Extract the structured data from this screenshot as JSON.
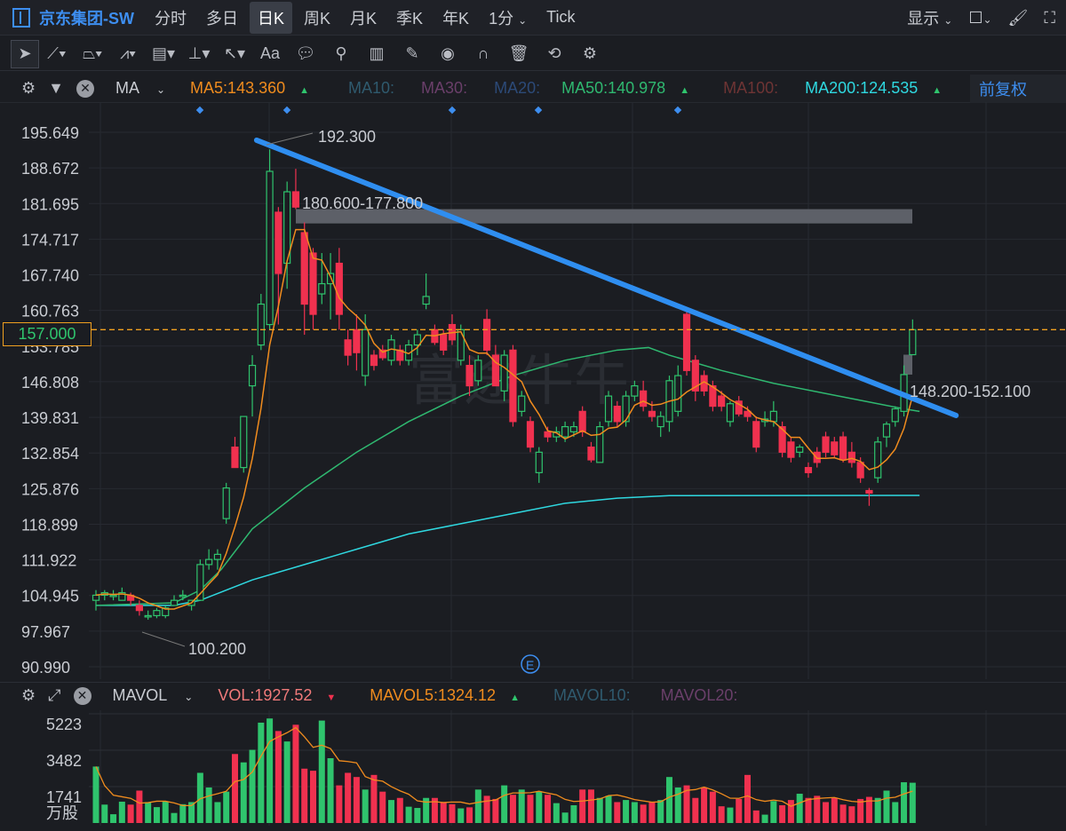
{
  "header": {
    "title": "京东集团-SW",
    "tabs": [
      "分时",
      "多日",
      "日K",
      "周K",
      "月K",
      "季K",
      "年K",
      "1分",
      "Tick"
    ],
    "active_tab": "日K",
    "display_label": "显示"
  },
  "toolbar": {
    "tools": [
      "cursor-icon",
      "line-icon",
      "polyline-icon",
      "wave-icon",
      "fib-icon",
      "range-icon",
      "arrow-icon",
      "text-icon",
      "comment-icon",
      "search-icon",
      "candle-add-icon",
      "pen-icon",
      "eye-icon",
      "magnet-icon",
      "trash-icon",
      "sync-icon",
      "gear-icon"
    ],
    "text_tool_label": "Aa"
  },
  "indicators": {
    "name": "MA",
    "ma5": "MA5:143.360",
    "ma10": "MA10:",
    "ma30": "MA30:",
    "ma20": "MA20:",
    "ma50": "MA50:140.978",
    "ma100": "MA100:",
    "ma200": "MA200:124.535",
    "adjust": "前复权"
  },
  "volume_header": {
    "name": "MAVOL",
    "vol": "VOL:1927.52",
    "mavol5": "MAVOL5:1324.12",
    "mavol10": "MAVOL10:",
    "mavol20": "MAVOL20:"
  },
  "colors": {
    "up": "#2fc46d",
    "down": "#f0314f",
    "ma5": "#f08c1e",
    "ma50": "#2fb870",
    "ma200": "#2fd8e0",
    "trendline": "#2f8ef0",
    "accent": "#3d8ef0"
  },
  "watermark": "富途牛牛",
  "chart_data": {
    "type": "candlestick",
    "y_ticks": [
      "195.649",
      "188.672",
      "181.695",
      "174.717",
      "167.740",
      "160.763",
      "153.785",
      "146.808",
      "139.831",
      "132.854",
      "125.876",
      "118.899",
      "111.922",
      "104.945",
      "97.967",
      "90.990"
    ],
    "ylim": [
      90.99,
      195.649
    ],
    "current_price": "157.000",
    "annotations": {
      "high": "192.300",
      "low": "100.200",
      "gap1": "180.600-177.800",
      "gap2": "148.200-152.100"
    },
    "gaps": [
      [
        177.8,
        180.6
      ],
      [
        148.2,
        152.1
      ]
    ],
    "event_marker": "E",
    "ohlc": [
      [
        104,
        106,
        102,
        105
      ],
      [
        105,
        106,
        104,
        105.5
      ],
      [
        105,
        106,
        104,
        105
      ],
      [
        104,
        106.5,
        104,
        105.5
      ],
      [
        105,
        105.5,
        103,
        104
      ],
      [
        103,
        104,
        101,
        102
      ],
      [
        101,
        102,
        100.2,
        101
      ],
      [
        101,
        102.5,
        100.5,
        102
      ],
      [
        101,
        103,
        100.5,
        102.5
      ],
      [
        103,
        105,
        103,
        104
      ],
      [
        105,
        106,
        104,
        105
      ],
      [
        103,
        104,
        102,
        104
      ],
      [
        104,
        112,
        104,
        111
      ],
      [
        111,
        114,
        110,
        112
      ],
      [
        112,
        114,
        110,
        113
      ],
      [
        120,
        127,
        119,
        126
      ],
      [
        134,
        136,
        131,
        130
      ],
      [
        130,
        140,
        129,
        140
      ],
      [
        146,
        152,
        140,
        150
      ],
      [
        154,
        164,
        153,
        162
      ],
      [
        158,
        192.3,
        157,
        188
      ],
      [
        180,
        181,
        158,
        168
      ],
      [
        170,
        186,
        165,
        184
      ],
      [
        184,
        188.5,
        180.6,
        181
      ],
      [
        176,
        178,
        156,
        162
      ],
      [
        172,
        173,
        157,
        160
      ],
      [
        164,
        172,
        162,
        166
      ],
      [
        166,
        172,
        159,
        168
      ],
      [
        170,
        173,
        157,
        160
      ],
      [
        155,
        157,
        150,
        152
      ],
      [
        157,
        160,
        149,
        152.5
      ],
      [
        148,
        160,
        146,
        157
      ],
      [
        152,
        153,
        149,
        150
      ],
      [
        153,
        154,
        151,
        151.5
      ],
      [
        151,
        156,
        150,
        155
      ],
      [
        153,
        154,
        150,
        151
      ],
      [
        151,
        155,
        150,
        154
      ],
      [
        154,
        157,
        152,
        156
      ],
      [
        162,
        168,
        161,
        163.5
      ],
      [
        157,
        158,
        154,
        154.5
      ],
      [
        156,
        157,
        152,
        153
      ],
      [
        158,
        160,
        154,
        155
      ],
      [
        151,
        158,
        150,
        157
      ],
      [
        150,
        152,
        144,
        146
      ],
      [
        147,
        152,
        146,
        151
      ],
      [
        159,
        161,
        152,
        153
      ],
      [
        152,
        154,
        147,
        146
      ],
      [
        145,
        153,
        143,
        152
      ],
      [
        153,
        154,
        138,
        139
      ],
      [
        141,
        145,
        140,
        144
      ],
      [
        139,
        140,
        133,
        134
      ],
      [
        129,
        134,
        127,
        133
      ],
      [
        137,
        138,
        135,
        136
      ],
      [
        136,
        138,
        135,
        137
      ],
      [
        136,
        139,
        135,
        138
      ],
      [
        137,
        139,
        136,
        138
      ],
      [
        141,
        142,
        136,
        137
      ],
      [
        134,
        135,
        131,
        131.5
      ],
      [
        131,
        139,
        131,
        138
      ],
      [
        139,
        145,
        138,
        144
      ],
      [
        142,
        143,
        138,
        139
      ],
      [
        139,
        145,
        138,
        144
      ],
      [
        144,
        147,
        143,
        146
      ],
      [
        145,
        147,
        141,
        142
      ],
      [
        141,
        143,
        139,
        140
      ],
      [
        138,
        141,
        136,
        140
      ],
      [
        139,
        148,
        137,
        147
      ],
      [
        141,
        150,
        140,
        148
      ],
      [
        160,
        161,
        148,
        149
      ],
      [
        151,
        152,
        143,
        145
      ],
      [
        148,
        149,
        144,
        145
      ],
      [
        146,
        147,
        141,
        142
      ],
      [
        144,
        145,
        141,
        142
      ],
      [
        139,
        143,
        138,
        142.5
      ],
      [
        143,
        144,
        140,
        140.5
      ],
      [
        141,
        142,
        139,
        140
      ],
      [
        139,
        140,
        133,
        134
      ],
      [
        139,
        141,
        138,
        139.5
      ],
      [
        139,
        143,
        138,
        141
      ],
      [
        138,
        139,
        132,
        133
      ],
      [
        135,
        136,
        131,
        132
      ],
      [
        133,
        134.5,
        132,
        134
      ],
      [
        130,
        131,
        128,
        129
      ],
      [
        133,
        134,
        130,
        131
      ],
      [
        136,
        137,
        132,
        133
      ],
      [
        135,
        136,
        132,
        132.5
      ],
      [
        136,
        137,
        131,
        131.5
      ],
      [
        133,
        135,
        130,
        131
      ],
      [
        131,
        132,
        127,
        128
      ],
      [
        125.5,
        126,
        122.5,
        125
      ],
      [
        128,
        136,
        127,
        135
      ],
      [
        136,
        139,
        134,
        138.5
      ],
      [
        139,
        142,
        138,
        141.5
      ],
      [
        141,
        150,
        140,
        148.2
      ],
      [
        152.1,
        159,
        152,
        157
      ]
    ],
    "ma50": [
      [
        0,
        103
      ],
      [
        15,
        103.5
      ],
      [
        20,
        106
      ],
      [
        24,
        110
      ],
      [
        30,
        118
      ],
      [
        40,
        126
      ],
      [
        50,
        133
      ],
      [
        60,
        139
      ],
      [
        70,
        144
      ],
      [
        80,
        148
      ],
      [
        90,
        151
      ],
      [
        100,
        153
      ],
      [
        106,
        153.5
      ],
      [
        110,
        152
      ],
      [
        120,
        149
      ],
      [
        130,
        146.5
      ],
      [
        140,
        144.5
      ],
      [
        150,
        142.5
      ],
      [
        155,
        141.5
      ],
      [
        158,
        141
      ]
    ],
    "ma200": [
      [
        0,
        103
      ],
      [
        15,
        103
      ],
      [
        20,
        104
      ],
      [
        30,
        108
      ],
      [
        40,
        111
      ],
      [
        50,
        114
      ],
      [
        60,
        117
      ],
      [
        70,
        119
      ],
      [
        80,
        121
      ],
      [
        90,
        123
      ],
      [
        100,
        124
      ],
      [
        110,
        124.5
      ],
      [
        158,
        124.535
      ]
    ],
    "ma_index_scale": 0.6,
    "trendline": [
      [
        18.5,
        194.1
      ],
      [
        99,
        140.2
      ]
    ],
    "volume": {
      "y_ticks": [
        "5223",
        "3482",
        "1741"
      ],
      "unit": "万股",
      "ymax": 5223,
      "values": [
        2700,
        880,
        420,
        1020,
        880,
        1550,
        1000,
        760,
        1020,
        480,
        900,
        1000,
        2400,
        1700,
        1000,
        1500,
        3300,
        2900,
        3500,
        4800,
        5000,
        4400,
        3900,
        4700,
        2600,
        2500,
        4900,
        3100,
        1800,
        2400,
        2200,
        1600,
        2300,
        1500,
        1100,
        1200,
        780,
        720,
        1200,
        1200,
        1000,
        900,
        700,
        750,
        1600,
        1300,
        1150,
        1800,
        1350,
        1600,
        1350,
        1500,
        1350,
        950,
        500,
        850,
        1600,
        1600,
        1200,
        1300,
        1000,
        1100,
        1000,
        880,
        1000,
        1100,
        2200,
        1700,
        1800,
        1200,
        1700,
        1500,
        800,
        740,
        1150,
        2300,
        600,
        400,
        1050,
        850,
        1100,
        1400,
        1200,
        1300,
        1000,
        1200,
        880,
        800,
        1150,
        1250,
        1200,
        1550,
        1000,
        1950,
        1927.52
      ]
    }
  }
}
